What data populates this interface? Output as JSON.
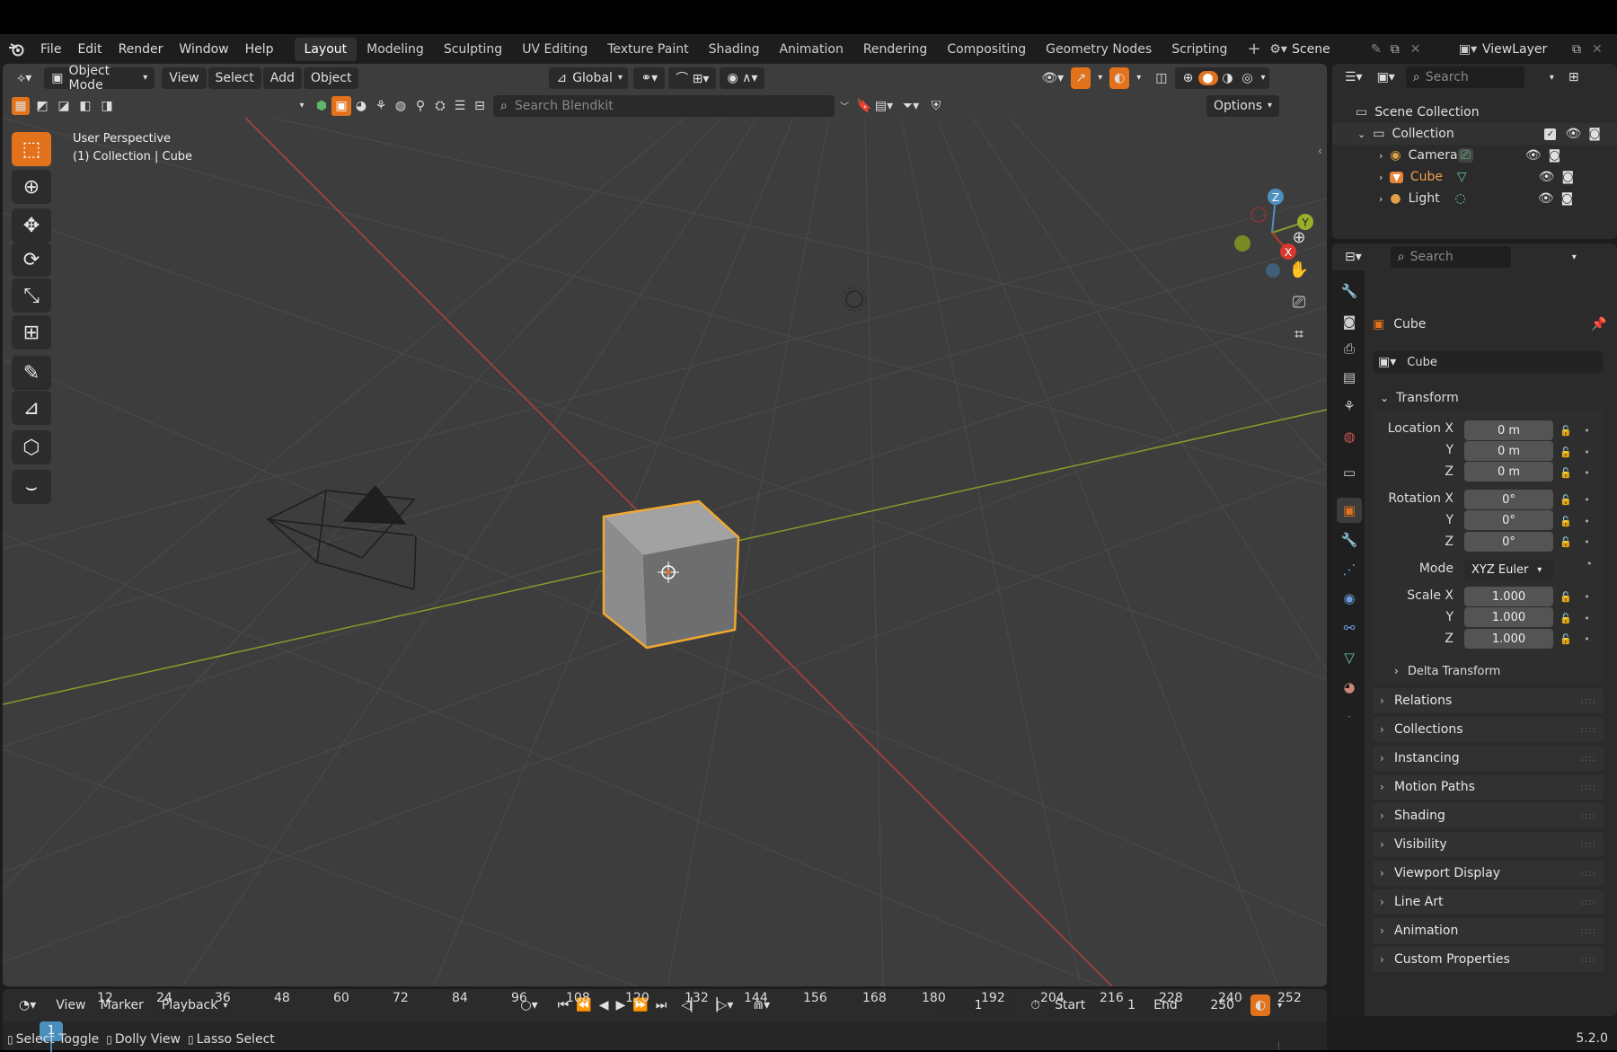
{
  "menu": {
    "items": [
      "File",
      "Edit",
      "Render",
      "Window",
      "Help"
    ]
  },
  "workspaces": [
    "Layout",
    "Modeling",
    "Sculpting",
    "UV Editing",
    "Texture Paint",
    "Shading",
    "Animation",
    "Rendering",
    "Compositing",
    "Geometry Nodes",
    "Scripting"
  ],
  "active_workspace": "Layout",
  "scene": {
    "name": "Scene",
    "view_layer": "ViewLayer"
  },
  "viewport": {
    "mode": "Object Mode",
    "menus": [
      "View",
      "Select",
      "Add",
      "Object"
    ],
    "orientation": "Global",
    "search_placeholder": "Search Blendkit",
    "options_label": "Options",
    "overlay_line1": "User Perspective",
    "overlay_line2": "(1) Collection | Cube",
    "gizmo_axes": {
      "x": "X",
      "y": "Y",
      "z": "Z"
    }
  },
  "outliner": {
    "search_placeholder": "Search",
    "root": "Scene Collection",
    "collection": "Collection",
    "items": [
      {
        "name": "Camera",
        "color": "#e0a048"
      },
      {
        "name": "Cube",
        "color": "#e6843a"
      },
      {
        "name": "Light",
        "color": "#e0a048"
      }
    ]
  },
  "properties": {
    "search_placeholder": "Search",
    "object_name": "Cube",
    "datablock_name": "Cube",
    "transform_label": "Transform",
    "location_label": "Location X",
    "rotation_label": "Rotation X",
    "scale_label": "Scale X",
    "mode_label": "Mode",
    "axis_y": "Y",
    "axis_z": "Z",
    "location": [
      "0 m",
      "0 m",
      "0 m"
    ],
    "rotation": [
      "0°",
      "0°",
      "0°"
    ],
    "rotation_mode": "XYZ Euler",
    "scale": [
      "1.000",
      "1.000",
      "1.000"
    ],
    "delta_transform": "Delta Transform",
    "sections": [
      "Relations",
      "Collections",
      "Instancing",
      "Motion Paths",
      "Shading",
      "Visibility",
      "Viewport Display",
      "Line Art",
      "Animation",
      "Custom Properties"
    ]
  },
  "timeline": {
    "menus": [
      "View",
      "Marker"
    ],
    "playback": "Playback",
    "current_frame": "1",
    "start_label": "Start",
    "start": "1",
    "end_label": "End",
    "end": "250",
    "ruler": [
      "1",
      "12",
      "24",
      "36",
      "48",
      "60",
      "72",
      "84",
      "96",
      "108",
      "120",
      "132",
      "144",
      "156",
      "168",
      "180",
      "192",
      "204",
      "216",
      "228",
      "240",
      "252"
    ]
  },
  "status": {
    "items": [
      "Select Toggle",
      "Dolly View",
      "Lasso Select"
    ],
    "version": "5.2.0"
  },
  "colors": {
    "accent": "#e2731c",
    "selected_outline": "#f0a830",
    "x_axis": "#c0392b",
    "y_axis": "#8a9a2a"
  }
}
